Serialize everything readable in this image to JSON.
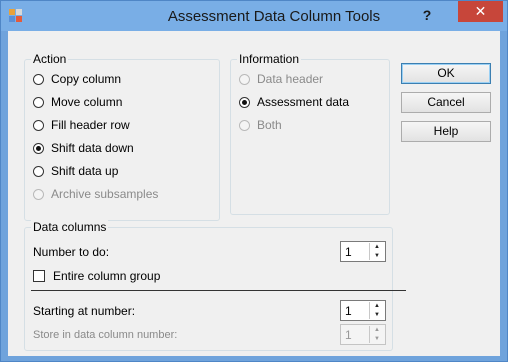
{
  "window": {
    "title": "Assessment Data Column Tools",
    "help_glyph": "?",
    "close_glyph": "✕"
  },
  "action": {
    "legend": "Action",
    "options": [
      {
        "label": "Copy column",
        "checked": false,
        "disabled": false
      },
      {
        "label": "Move column",
        "checked": false,
        "disabled": false
      },
      {
        "label": "Fill header row",
        "checked": false,
        "disabled": false
      },
      {
        "label": "Shift data down",
        "checked": true,
        "disabled": false
      },
      {
        "label": "Shift data up",
        "checked": false,
        "disabled": false
      },
      {
        "label": "Archive subsamples",
        "checked": false,
        "disabled": true
      }
    ]
  },
  "information": {
    "legend": "Information",
    "options": [
      {
        "label": "Data header",
        "checked": false,
        "disabled": true
      },
      {
        "label": "Assessment data",
        "checked": true,
        "disabled": false
      },
      {
        "label": "Both",
        "checked": false,
        "disabled": true
      }
    ]
  },
  "buttons": {
    "ok": "OK",
    "cancel": "Cancel",
    "help": "Help"
  },
  "data_columns": {
    "legend": "Data columns",
    "number_to_do_label": "Number to do:",
    "number_to_do_value": "1",
    "entire_group_label": "Entire column group",
    "starting_at_label": "Starting at number:",
    "starting_at_value": "1",
    "store_in_label": "Store in data column number:",
    "store_in_value": "1"
  }
}
